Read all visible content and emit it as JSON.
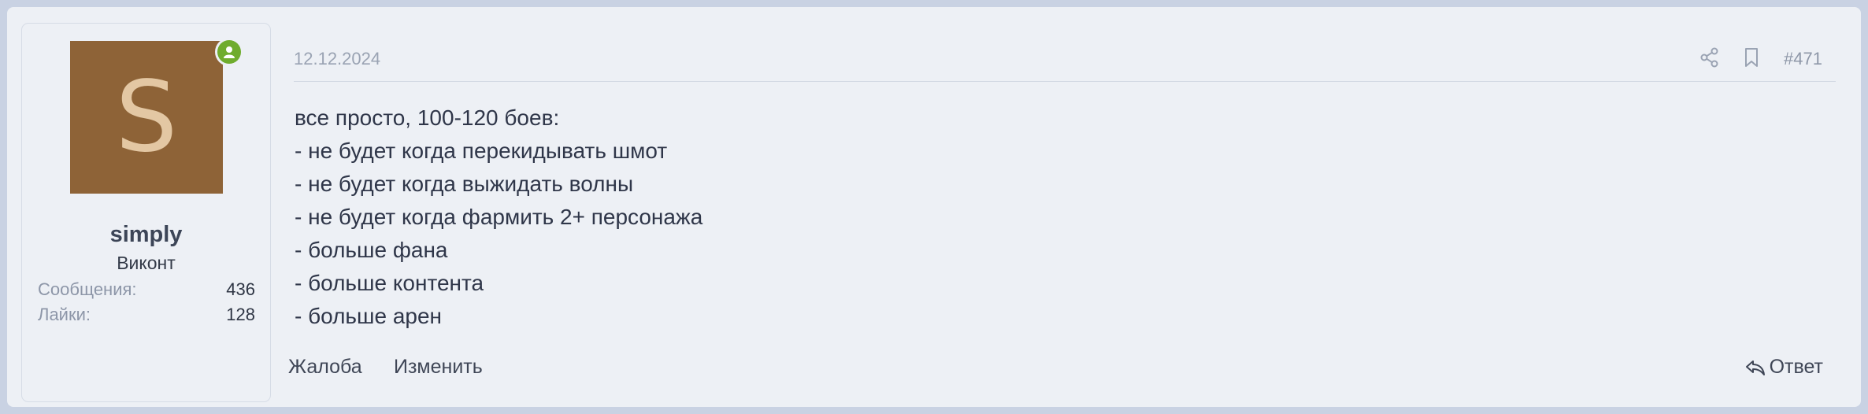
{
  "user": {
    "avatar_letter": "S",
    "username": "simply",
    "title": "Виконт",
    "stats": [
      {
        "label": "Сообщения:",
        "value": "436"
      },
      {
        "label": "Лайки:",
        "value": "128"
      }
    ]
  },
  "post": {
    "date": "12.12.2024",
    "number": "#471",
    "lines": [
      "все просто, 100-120 боев:",
      "- не будет когда перекидывать шмот",
      "- не будет когда выжидать волны",
      "- не будет когда фармить 2+ персонажа",
      "- больше фана",
      "- больше контента",
      "- больше арен"
    ]
  },
  "actions": {
    "report_label": "Жалоба",
    "edit_label": "Изменить",
    "reply_label": "Ответ"
  },
  "icons": {
    "online": "user-online-icon",
    "share": "share-icon",
    "bookmark": "bookmark-icon",
    "reply": "reply-arrow-icon"
  },
  "colors": {
    "avatar_bg": "#8e6337",
    "online_badge": "#6fac2e",
    "post_bg": "#edf0f5"
  }
}
